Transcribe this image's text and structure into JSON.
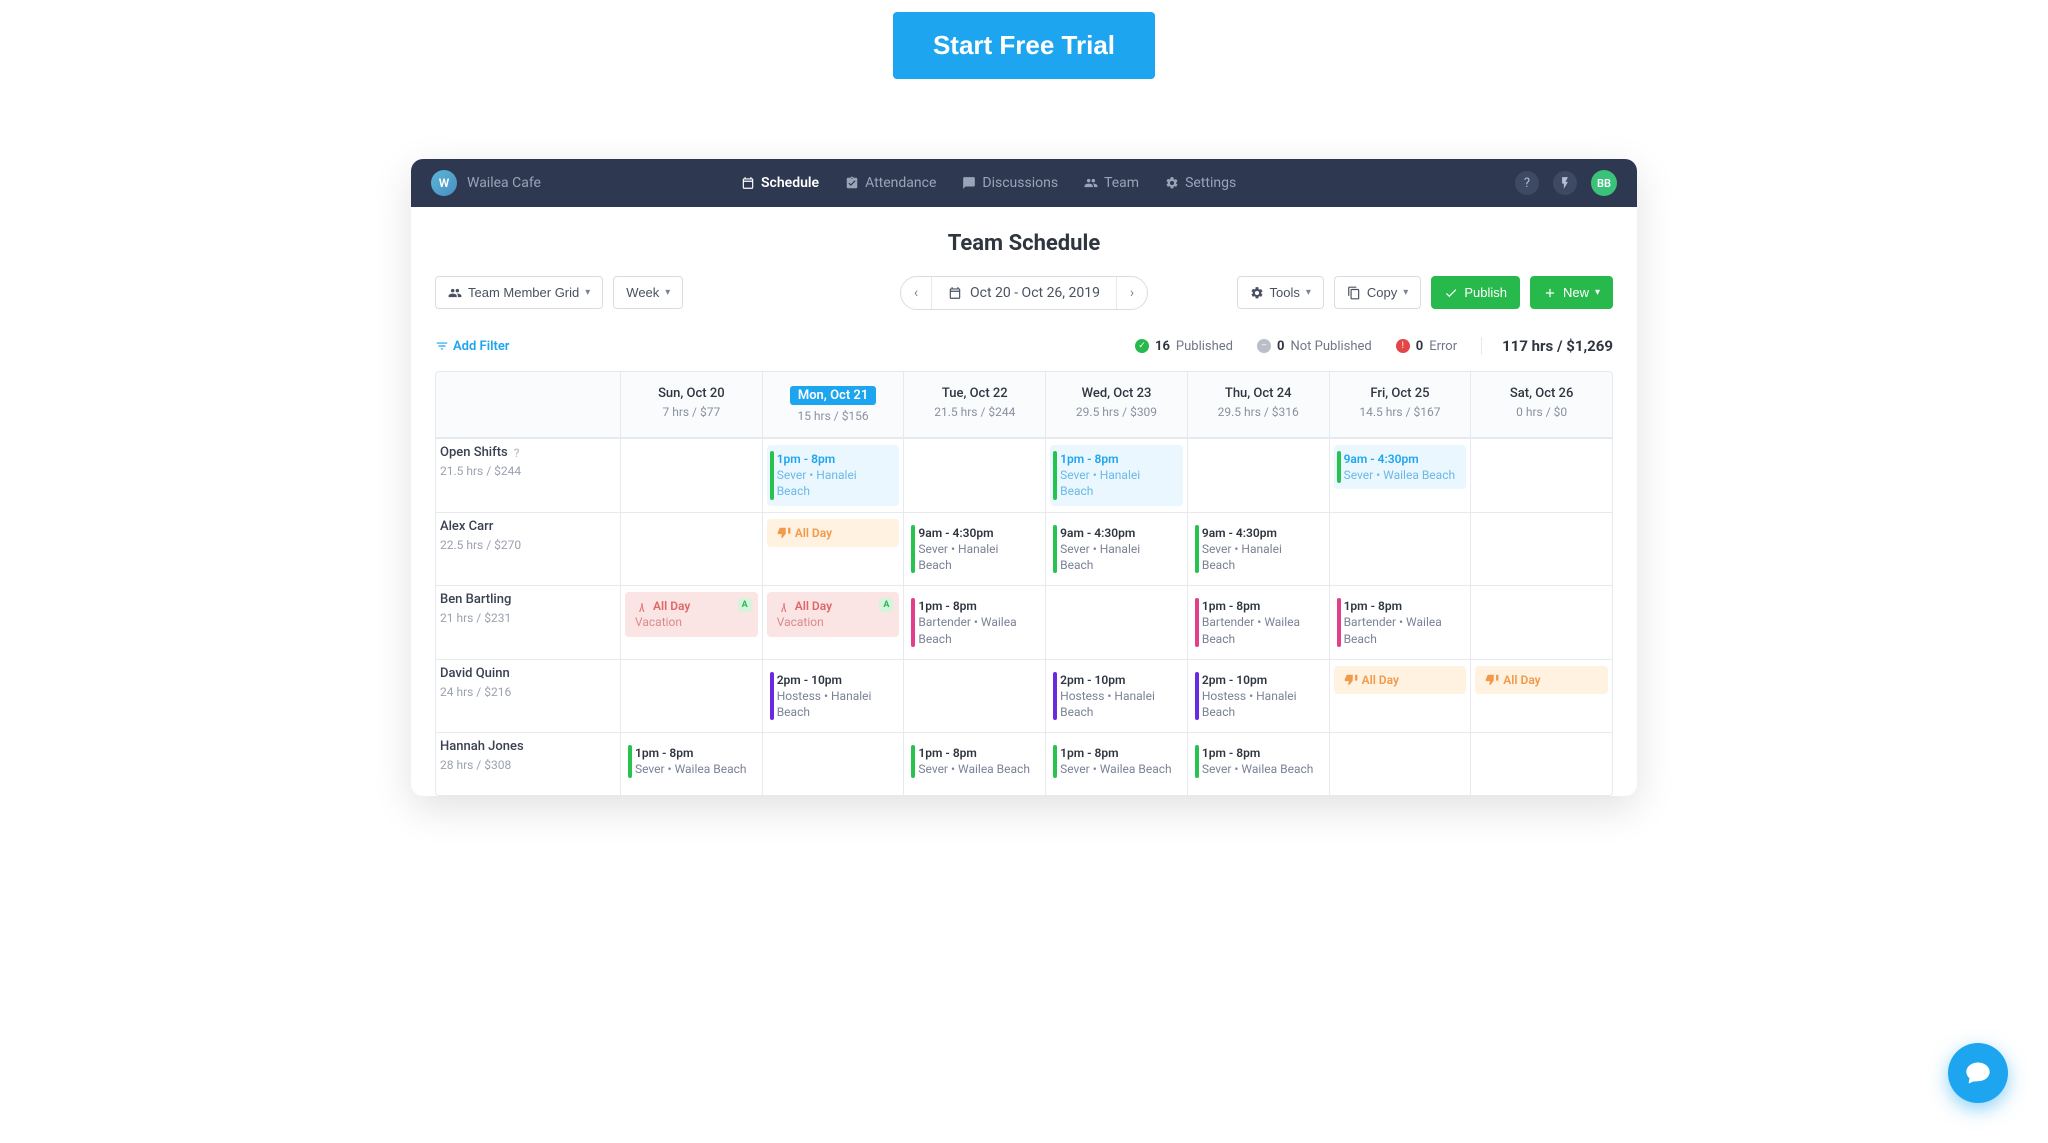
{
  "cta": {
    "label": "Start Free Trial"
  },
  "workspace": {
    "initial": "W",
    "name": "Wailea Cafe"
  },
  "topnav": {
    "schedule": "Schedule",
    "attendance": "Attendance",
    "discussions": "Discussions",
    "team": "Team",
    "settings": "Settings"
  },
  "user_avatar": "BB",
  "page_title": "Team Schedule",
  "toolbar": {
    "view_mode": "Team Member Grid",
    "period": "Week",
    "date_range": "Oct 20 - Oct 26, 2019",
    "tools": "Tools",
    "copy": "Copy",
    "publish": "Publish",
    "new": "New"
  },
  "status": {
    "add_filter": "Add Filter",
    "published_n": "16",
    "published_label": "Published",
    "not_published_n": "0",
    "not_published_label": "Not Published",
    "error_n": "0",
    "error_label": "Error",
    "totals": "117 hrs / $1,269"
  },
  "days": [
    {
      "label": "Sun, Oct 20",
      "sub": "7 hrs / $77",
      "active": false
    },
    {
      "label": "Mon, Oct 21",
      "sub": "15 hrs / $156",
      "active": true
    },
    {
      "label": "Tue, Oct 22",
      "sub": "21.5 hrs / $244",
      "active": false
    },
    {
      "label": "Wed, Oct 23",
      "sub": "29.5 hrs / $309",
      "active": false
    },
    {
      "label": "Thu, Oct 24",
      "sub": "29.5 hrs / $316",
      "active": false
    },
    {
      "label": "Fri, Oct 25",
      "sub": "14.5 hrs / $167",
      "active": false
    },
    {
      "label": "Sat, Oct 26",
      "sub": "0 hrs / $0",
      "active": false
    }
  ],
  "rows": [
    {
      "name": "Open Shifts",
      "sub": "21.5 hrs / $244",
      "help": true,
      "cells": [
        null,
        {
          "type": "open",
          "bar": "bar-green",
          "time": "1pm - 8pm",
          "detail": "Sever • Hanalei Beach"
        },
        null,
        {
          "type": "open",
          "bar": "bar-green",
          "time": "1pm - 8pm",
          "detail": "Sever • Hanalei Beach"
        },
        null,
        {
          "type": "open",
          "bar": "bar-green",
          "time": "9am - 4:30pm",
          "detail": "Sever • Wailea Beach"
        },
        null
      ]
    },
    {
      "name": "Alex Carr",
      "sub": "22.5 hrs / $270",
      "cells": [
        null,
        {
          "type": "timeoff",
          "time": "All Day"
        },
        {
          "type": "shift",
          "bar": "bar-green",
          "time": "9am - 4:30pm",
          "detail": "Sever • Hanalei Beach"
        },
        {
          "type": "shift",
          "bar": "bar-green",
          "time": "9am - 4:30pm",
          "detail": "Sever • Hanalei Beach"
        },
        {
          "type": "shift",
          "bar": "bar-green",
          "time": "9am - 4:30pm",
          "detail": "Sever • Hanalei Beach"
        },
        null,
        null
      ]
    },
    {
      "name": "Ben Bartling",
      "sub": "21 hrs / $231",
      "cells": [
        {
          "type": "vacation",
          "time": "All Day",
          "detail": "Vacation",
          "badge": "A"
        },
        {
          "type": "vacation",
          "time": "All Day",
          "detail": "Vacation",
          "badge": "A"
        },
        {
          "type": "shift",
          "bar": "bar-pink",
          "time": "1pm - 8pm",
          "detail": "Bartender • Wailea Beach"
        },
        null,
        {
          "type": "shift",
          "bar": "bar-pink",
          "time": "1pm - 8pm",
          "detail": "Bartender • Wailea Beach"
        },
        {
          "type": "shift",
          "bar": "bar-pink",
          "time": "1pm - 8pm",
          "detail": "Bartender • Wailea Beach"
        },
        null
      ]
    },
    {
      "name": "David Quinn",
      "sub": "24 hrs / $216",
      "cells": [
        null,
        {
          "type": "shift",
          "bar": "bar-purple",
          "time": "2pm - 10pm",
          "detail": "Hostess • Hanalei Beach"
        },
        null,
        {
          "type": "shift",
          "bar": "bar-purple",
          "time": "2pm - 10pm",
          "detail": "Hostess • Hanalei Beach"
        },
        {
          "type": "shift",
          "bar": "bar-purple",
          "time": "2pm - 10pm",
          "detail": "Hostess • Hanalei Beach"
        },
        {
          "type": "timeoff",
          "time": "All Day"
        },
        {
          "type": "timeoff",
          "time": "All Day"
        }
      ]
    },
    {
      "name": "Hannah Jones",
      "sub": "28 hrs / $308",
      "cells": [
        {
          "type": "shift",
          "bar": "bar-green",
          "time": "1pm - 8pm",
          "detail": "Sever • Wailea Beach"
        },
        null,
        {
          "type": "shift",
          "bar": "bar-green",
          "time": "1pm - 8pm",
          "detail": "Sever • Wailea Beach"
        },
        {
          "type": "shift",
          "bar": "bar-green",
          "time": "1pm - 8pm",
          "detail": "Sever • Wailea Beach"
        },
        {
          "type": "shift",
          "bar": "bar-green",
          "time": "1pm - 8pm",
          "detail": "Sever • Wailea Beach"
        },
        null,
        null
      ]
    }
  ]
}
